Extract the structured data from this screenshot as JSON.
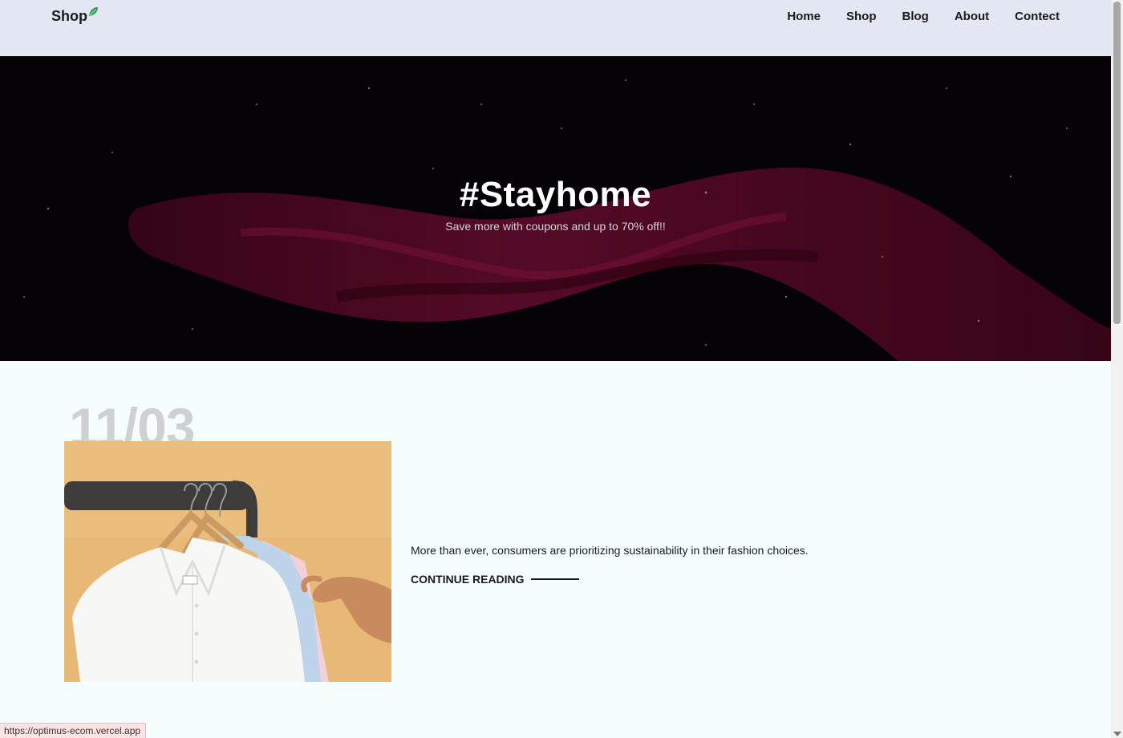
{
  "header": {
    "logo": "Shop",
    "nav": [
      "Home",
      "Shop",
      "Blog",
      "About",
      "Contect"
    ]
  },
  "hero": {
    "title": "#Stayhome",
    "subtitle": "Save more with coupons and up to 70% off!!"
  },
  "blog": {
    "date": "11/03",
    "excerpt": "More than ever, consumers are prioritizing sustainability in their fashion choices.",
    "read_more": "CONTINUE READING"
  },
  "status_bar": {
    "url": "https://optimus-ecom.vercel.app"
  },
  "colors": {
    "header_bg": "#e3e6f3",
    "page_bg": "#f6fdff",
    "leaf": "#2ea44f",
    "date_text": "#d0d0d4",
    "fabric": "#5a0a28"
  }
}
